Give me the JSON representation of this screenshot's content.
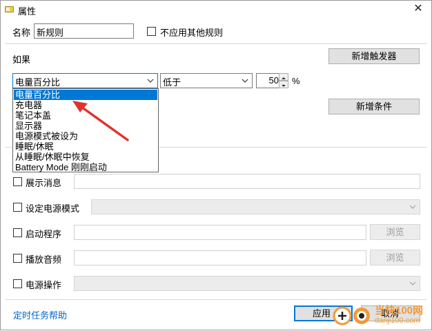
{
  "window": {
    "title": "属性",
    "close_glyph": "✕"
  },
  "name_row": {
    "label": "名称",
    "value": "新规则",
    "no_other_rules_label": "不应用其他规则"
  },
  "if_section": {
    "label": "如果",
    "add_trigger_label": "新增触发器"
  },
  "condition": {
    "trigger_value": "电量百分比",
    "operator_value": "低于",
    "number_value": "50",
    "unit": "%",
    "add_condition_label": "新增条件"
  },
  "dropdown": {
    "options": [
      "电量百分比",
      "充电器",
      "笔记本盖",
      "显示器",
      "电源模式被设为",
      "睡眠/休眠",
      "从睡眠/休眠中恢复",
      "Battery Mode 刚刚启动"
    ],
    "selected_index": 0
  },
  "actions": {
    "show_message_label": "展示消息",
    "set_power_mode_label": "设定电源模式",
    "start_program_label": "启动程序",
    "play_audio_label": "播放音频",
    "power_operation_label": "电源操作",
    "browse_label": "浏览"
  },
  "footer": {
    "help_link": "定时任务帮助",
    "apply_label": "应用",
    "cancel_label": "取消"
  },
  "watermark": {
    "site_cn": "当快100网",
    "site_url": "danji100.com"
  },
  "colors": {
    "accent": "#0078d7",
    "link": "#0066cc",
    "arrow": "#e0332e"
  }
}
